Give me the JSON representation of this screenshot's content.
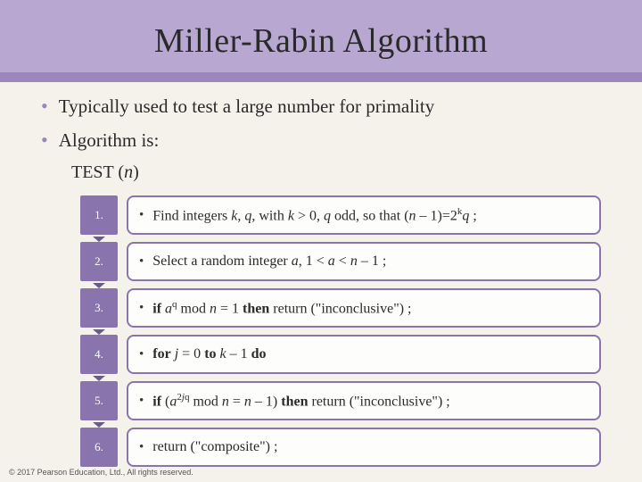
{
  "title": "Miller-Rabin Algorithm",
  "bullets": [
    "Typically used to test a large number for primality",
    "Algorithm is:"
  ],
  "test_label_prefix": "TEST (",
  "test_label_var": "n",
  "test_label_suffix": ")",
  "steps": [
    {
      "num": "1.",
      "html": "Find integers <span class='ital'>k</span>, <span class='ital'>q</span>, with <span class='ital'>k</span> &gt; 0, <span class='ital'>q</span> odd, so that (<span class='ital'>n</span> – 1)=2<span class='sup'>k</span><span class='ital'>q</span> ;"
    },
    {
      "num": "2.",
      "html": "Select a random integer <span class='ital'>a</span>, 1 &lt; <span class='ital'>a</span> &lt; <span class='ital'>n</span> – 1 ;"
    },
    {
      "num": "3.",
      "html": "<b>if</b> <span class='ital'>a</span><span class='sup'>q</span> mod <span class='ital'>n</span> = 1 <b>then</b> return (\"inconclusive\") ;"
    },
    {
      "num": "4.",
      "html": "<b>for</b> <span class='ital'>j</span> = 0 <b>to</b> <span class='ital'>k</span> – 1 <b>do</b>"
    },
    {
      "num": "5.",
      "html": "<b>if</b> (<span class='ital'>a</span><span class='sup'>2<span class='ital'>j</span>q</span> mod <span class='ital'>n</span> = <span class='ital'>n</span> – 1) <b>then</b> return (\"inconclusive\") ;"
    },
    {
      "num": "6.",
      "html": "return (\"composite\") ;"
    }
  ],
  "footer": "© 2017 Pearson Education, Ltd., All rights reserved."
}
